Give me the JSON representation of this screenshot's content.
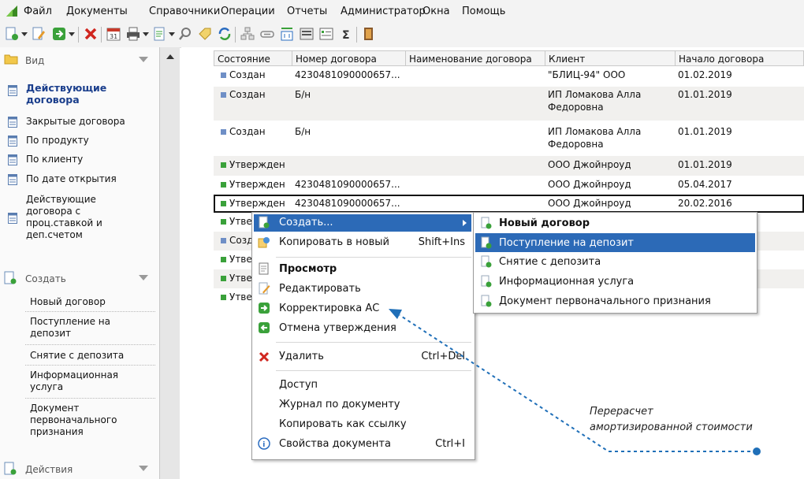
{
  "menubar": {
    "items": [
      "Файл",
      "Документы",
      "Справочники",
      "Операции",
      "Отчеты",
      "Администратор",
      "Окна",
      "Помощь"
    ]
  },
  "sidebar": {
    "view_title": "Вид",
    "view_items": [
      "Действующие договора",
      "Закрытые договора",
      "По продукту",
      "По клиенту",
      "По дате открытия",
      "Действующие договора с проц.ставкой и деп.счетом"
    ],
    "create_title": "Создать",
    "create_items": [
      "Новый договор",
      "Поступление на депозит",
      "Снятие с депозита",
      "Информационная услуга",
      "Документ первоначального признания"
    ],
    "actions_title": "Действия"
  },
  "grid": {
    "columns": [
      "Состояние",
      "Номер договора",
      "Наименование договора",
      "Клиент",
      "Начало договора"
    ],
    "rows": [
      {
        "status": "Создан",
        "number": "4230481090000657...",
        "name": "",
        "client": "\"БЛИЦ-94\" ООО",
        "client2": "",
        "start": "01.02.2019",
        "color": "blue"
      },
      {
        "status": "Создан",
        "number": "Б/н",
        "name": "",
        "client": "ИП Ломакова Алла",
        "client2": "Федоровна",
        "start": "01.01.2019",
        "color": "blue"
      },
      {
        "status": "Создан",
        "number": "Б/н",
        "name": "",
        "client": "ИП Ломакова Алла",
        "client2": "Федоровна",
        "start": "01.01.2019",
        "color": "blue"
      },
      {
        "status": "Утвержден",
        "number": "",
        "name": "",
        "client": "ООО Джойнроуд",
        "client2": "",
        "start": "01.01.2019",
        "color": "green"
      },
      {
        "status": "Утвержден",
        "number": "4230481090000657...",
        "name": "",
        "client": "ООО Джойнроуд",
        "client2": "",
        "start": "05.04.2017",
        "color": "green"
      },
      {
        "status": "Утвержден",
        "number": "4230481090000657...",
        "name": "",
        "client": "ООО Джойнроуд",
        "client2": "",
        "start": "20.02.2016",
        "color": "green"
      },
      {
        "status": "Утве",
        "color": "green"
      },
      {
        "status": "Созд",
        "color": "blue"
      },
      {
        "status": "Утве",
        "color": "green"
      },
      {
        "status": "Утве",
        "color": "green"
      },
      {
        "status": "Утве",
        "color": "green"
      }
    ]
  },
  "context_menu": {
    "items": [
      {
        "label": "Создать...",
        "shortcut": ""
      },
      {
        "label": "Копировать в новый",
        "shortcut": "Shift+Ins"
      },
      {
        "label": "Просмотр",
        "shortcut": ""
      },
      {
        "label": "Редактировать",
        "shortcut": ""
      },
      {
        "label": "Корректировка АС",
        "shortcut": ""
      },
      {
        "label": "Отмена утверждения",
        "shortcut": ""
      },
      {
        "label": "Удалить",
        "shortcut": "Ctrl+Del"
      },
      {
        "label": "Доступ",
        "shortcut": ""
      },
      {
        "label": "Журнал по документу",
        "shortcut": ""
      },
      {
        "label": "Копировать как ссылку",
        "shortcut": ""
      },
      {
        "label": "Свойства документа",
        "shortcut": "Ctrl+I"
      }
    ]
  },
  "submenu": {
    "items": [
      "Новый договор",
      "Поступление на депозит",
      "Снятие с депозита",
      "Информационная услуга",
      "Документ первоначального признания"
    ]
  },
  "annotation": {
    "line1": "Перерасчет",
    "line2": "амортизированной стоимости"
  },
  "colors": {
    "highlight": "#2c6ab7",
    "title_blue": "#1a3e8c",
    "green_status": "#3aa13a",
    "blue_status": "#6f8fc6",
    "callout": "#1f6fb8"
  }
}
